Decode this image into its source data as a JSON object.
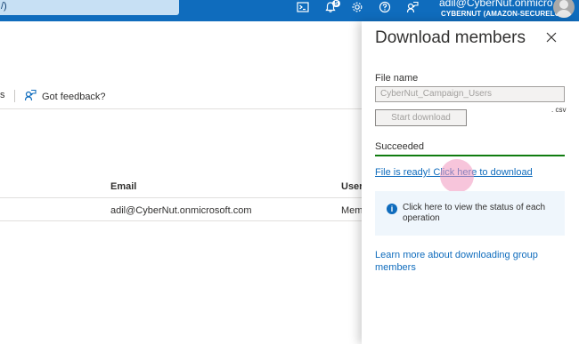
{
  "topbar": {
    "search_fragment": "/)",
    "notification_count": "5",
    "account_name": "adil@CyberNut.onmicro...",
    "account_tenant": "CYBERNUT (AMAZON-SECURELO..."
  },
  "commandbar": {
    "partial_label": "s",
    "feedback_label": "Got feedback?"
  },
  "table": {
    "columns": [
      "Email",
      "User"
    ],
    "rows": [
      {
        "email": "adil@CyberNut.onmicrosoft.com",
        "user_partial": "Mem"
      }
    ]
  },
  "panel": {
    "title": "Download members",
    "file_name_label": "File name",
    "file_name_value": "CyberNut_Campaign_Users",
    "file_extension": ". csv",
    "start_button": "Start download",
    "status": "Succeeded",
    "download_link": "File is ready! Click here to download",
    "info_text": "Click here to view the status of each operation",
    "learn_more": "Learn more about downloading group members"
  },
  "colors": {
    "brand": "#0f6cbd",
    "success": "#107c10"
  }
}
